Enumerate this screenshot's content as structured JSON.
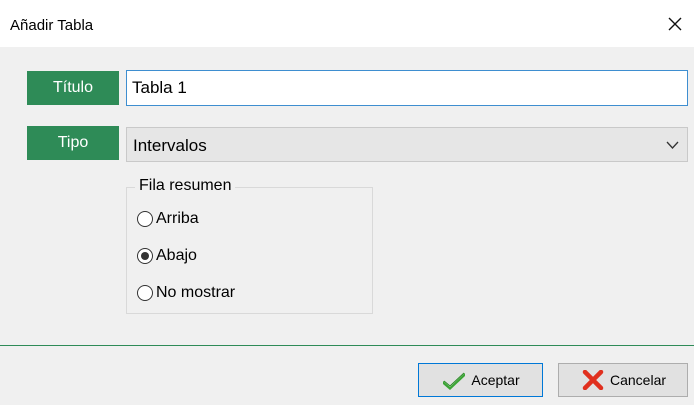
{
  "window": {
    "title": "Añadir Tabla",
    "close_icon": "close-icon"
  },
  "form": {
    "title_label": "Título",
    "title_value": "Tabla 1",
    "type_label": "Tipo",
    "type_value": "Intervalos"
  },
  "summary_group": {
    "legend": "Fila resumen",
    "options": [
      {
        "label": "Arriba",
        "checked": false
      },
      {
        "label": "Abajo",
        "checked": true
      },
      {
        "label": "No mostrar",
        "checked": false
      }
    ]
  },
  "footer": {
    "accept_label": "Aceptar",
    "accept_icon": "check-icon",
    "cancel_label": "Cancelar",
    "cancel_icon": "red-x-icon"
  },
  "colors": {
    "label_bg": "#2e8b57",
    "input_focus_border": "#3e8ed0",
    "check_green": "#3aa534",
    "cancel_red": "#e0301e"
  }
}
